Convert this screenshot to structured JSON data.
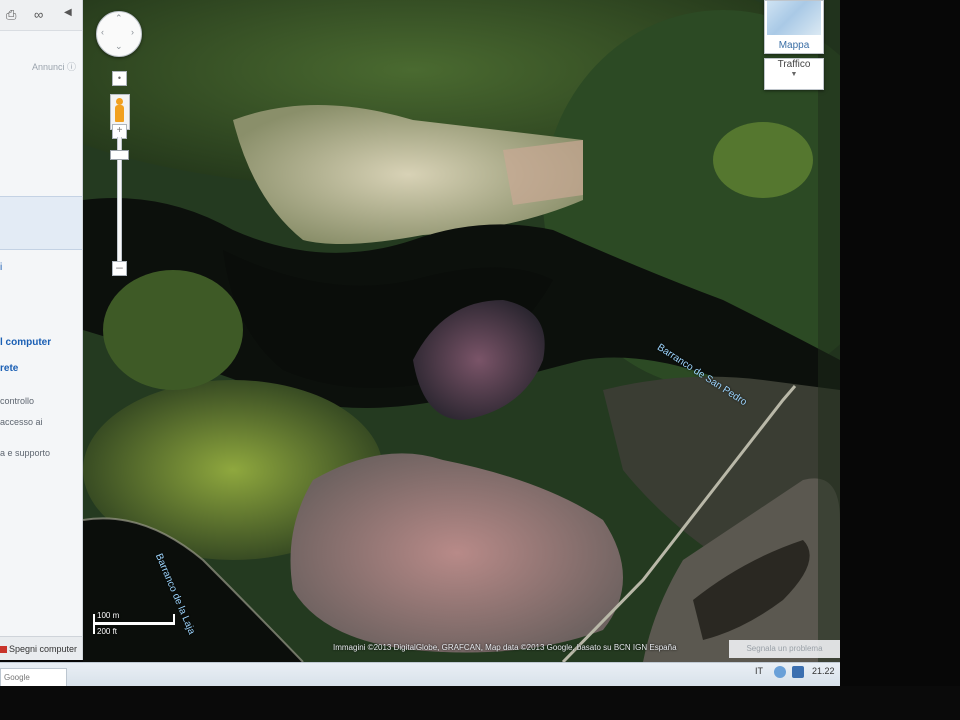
{
  "sidebar": {
    "ad_label": "Annunci",
    "links": [
      "i",
      "l computer",
      "rete"
    ],
    "texts": [
      "controllo",
      "accesso ai",
      "a e supporto"
    ],
    "shutdown_label": "Spegni computer",
    "search_text": "Google"
  },
  "map": {
    "type_button": {
      "label": "Mappa"
    },
    "traffic_button": {
      "label": "Traffico"
    },
    "labels": {
      "barranco_san_pedro": "Barranco de San Pedro",
      "barranco_laja": "Barranco de la Laja"
    },
    "scale": {
      "metric": "100 m",
      "imperial": "200 ft"
    },
    "attribution": "Immagini ©2013 DigitalGlobe, GRAFCAN, Map data ©2013 Google, basato su BCN IGN España",
    "report_link": "Segnala un problema"
  },
  "taskbar": {
    "language": "IT",
    "clock": "21.22"
  }
}
